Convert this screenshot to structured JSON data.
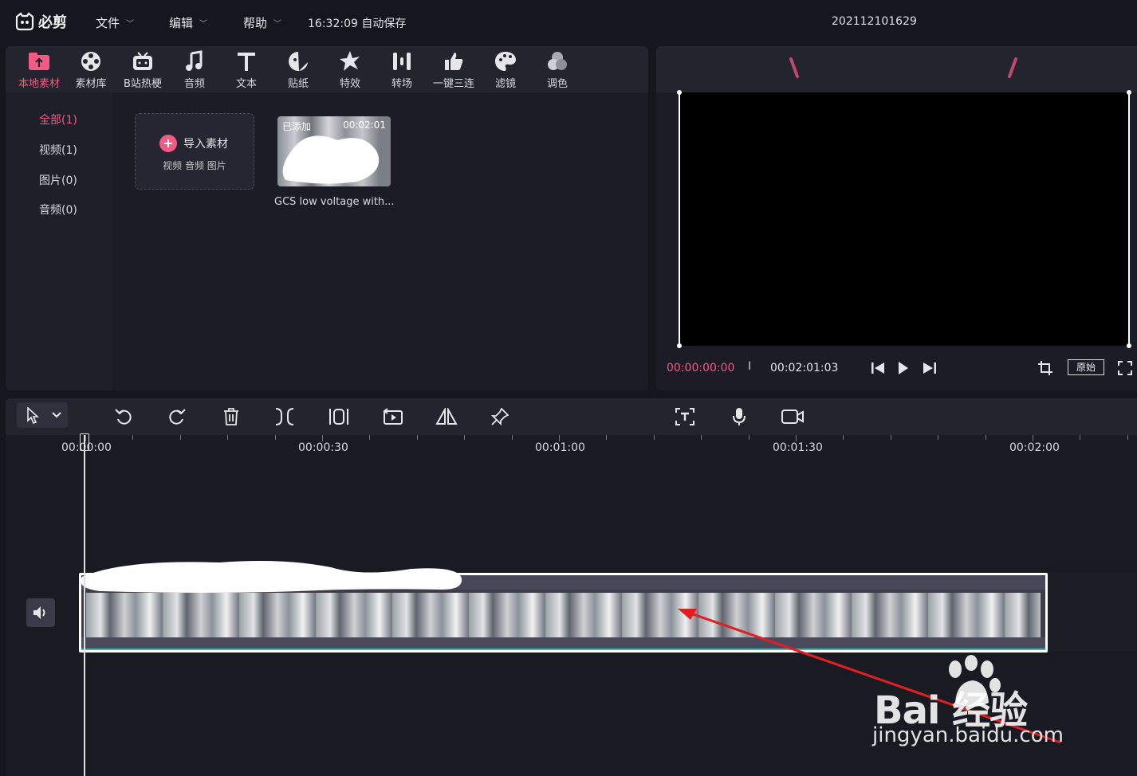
{
  "app": {
    "name": "必剪",
    "autosave": "16:32:09 自动保存",
    "project_name": "202112101629"
  },
  "menus": [
    {
      "label": "文件"
    },
    {
      "label": "编辑"
    },
    {
      "label": "帮助"
    }
  ],
  "tools": [
    {
      "label": "本地素材",
      "icon": "upload-folder-icon",
      "active": true
    },
    {
      "label": "素材库",
      "icon": "film-reel-icon"
    },
    {
      "label": "B站热梗",
      "icon": "tv-mascot-icon"
    },
    {
      "label": "音频",
      "icon": "music-note-icon"
    },
    {
      "label": "文本",
      "icon": "text-t-icon"
    },
    {
      "label": "贴纸",
      "icon": "sticker-icon"
    },
    {
      "label": "特效",
      "icon": "star-burst-icon"
    },
    {
      "label": "转场",
      "icon": "transition-bars-icon"
    },
    {
      "label": "一键三连",
      "icon": "thumbs-up-icon"
    },
    {
      "label": "滤镜",
      "icon": "palette-icon"
    },
    {
      "label": "调色",
      "icon": "color-circles-icon"
    }
  ],
  "categories": [
    {
      "label": "全部(1)",
      "active": true
    },
    {
      "label": "视频(1)"
    },
    {
      "label": "图片(0)"
    },
    {
      "label": "音频(0)"
    }
  ],
  "import": {
    "label": "导入素材",
    "sub": "视频 音频 图片"
  },
  "media_item": {
    "badge": "已添加",
    "duration": "00:02:01",
    "name": "GCS low voltage with..."
  },
  "preview": {
    "current_time": "00:00:00:00",
    "separator": "I",
    "total_time": "00:02:01:03",
    "ratio_label": "原始"
  },
  "ruler": {
    "labels": [
      "00:00:00",
      "00:00:30",
      "00:01:00",
      "00:01:30",
      "00:02:00"
    ]
  },
  "watermark": {
    "brand": "Bai 经验",
    "url": "jingyan.baidu.com"
  },
  "colors": {
    "accent": "#f25c82",
    "bg": "#16161f",
    "panel": "#1c1c26",
    "audio_line": "#3fb8b0"
  }
}
